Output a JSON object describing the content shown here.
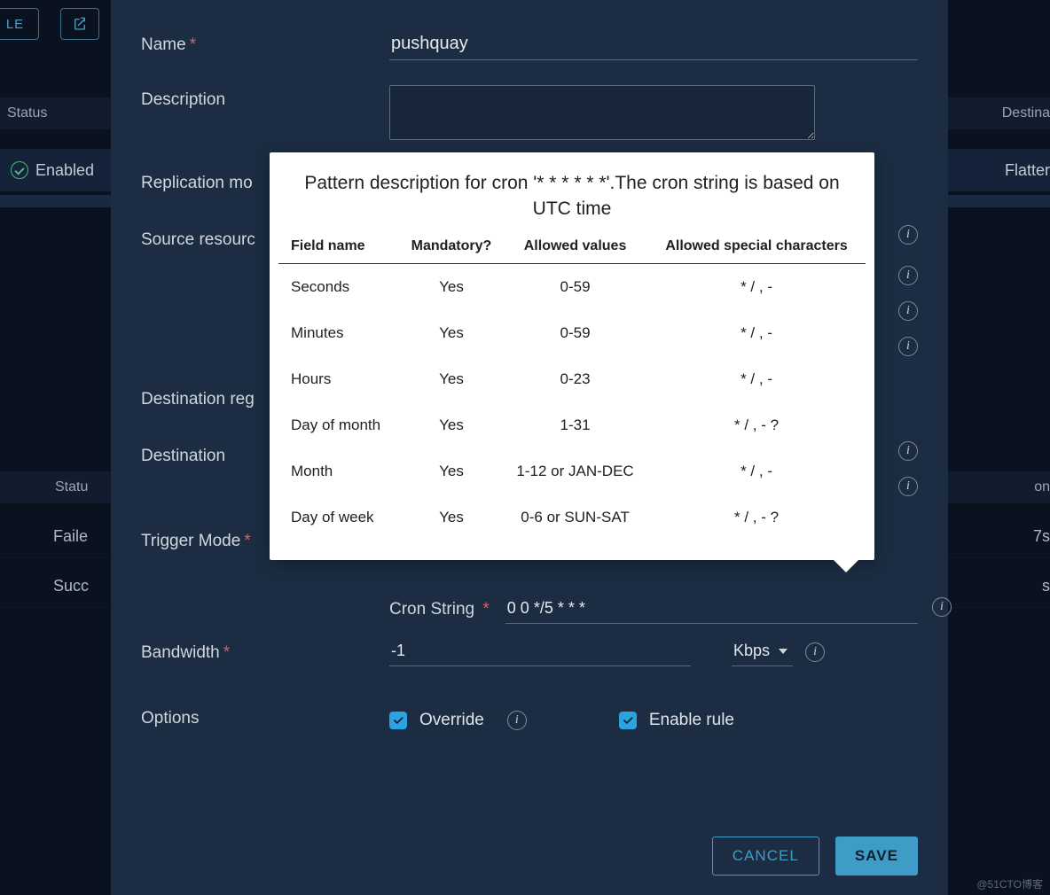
{
  "bg": {
    "btn_le": "LE",
    "hdr_status": "Status",
    "hdr_dest": "Destina",
    "enabled": "Enabled",
    "flatten": "Flatter",
    "statu2": "Statu",
    "on": "on",
    "fail": "Faile",
    "fail_val": "7s",
    "succ": "Succ",
    "succ_val": "s"
  },
  "form": {
    "name_label": "Name",
    "name_value": "pushquay",
    "desc_label": "Description",
    "desc_value": "",
    "repl_mode_label": "Replication mo",
    "src_label": "Source resourc",
    "dest_reg_label": "Destination reg",
    "dest_label": "Destination",
    "trigger_label": "Trigger Mode",
    "cron_label": "Cron String",
    "cron_value": "0 0 */5 * * *",
    "bw_label": "Bandwidth",
    "bw_value": "-1",
    "bw_unit": "Kbps",
    "opts_label": "Options",
    "override_label": "Override",
    "enable_label": "Enable rule"
  },
  "buttons": {
    "cancel": "CANCEL",
    "save": "SAVE"
  },
  "tooltip": {
    "title": "Pattern description for cron '* * * * * *'.The cron string is based on UTC time",
    "headers": [
      "Field name",
      "Mandatory?",
      "Allowed values",
      "Allowed special characters"
    ],
    "rows": [
      {
        "field": "Seconds",
        "mandatory": "Yes",
        "values": "0-59",
        "special": "* / , -"
      },
      {
        "field": "Minutes",
        "mandatory": "Yes",
        "values": "0-59",
        "special": "* / , -"
      },
      {
        "field": "Hours",
        "mandatory": "Yes",
        "values": "0-23",
        "special": "* / , -"
      },
      {
        "field": "Day of month",
        "mandatory": "Yes",
        "values": "1-31",
        "special": "* / , - ?"
      },
      {
        "field": "Month",
        "mandatory": "Yes",
        "values": "1-12 or JAN-DEC",
        "special": "* / , -"
      },
      {
        "field": "Day of week",
        "mandatory": "Yes",
        "values": "0-6 or SUN-SAT",
        "special": "* / , - ?"
      }
    ]
  },
  "watermark": "@51CTO博客"
}
